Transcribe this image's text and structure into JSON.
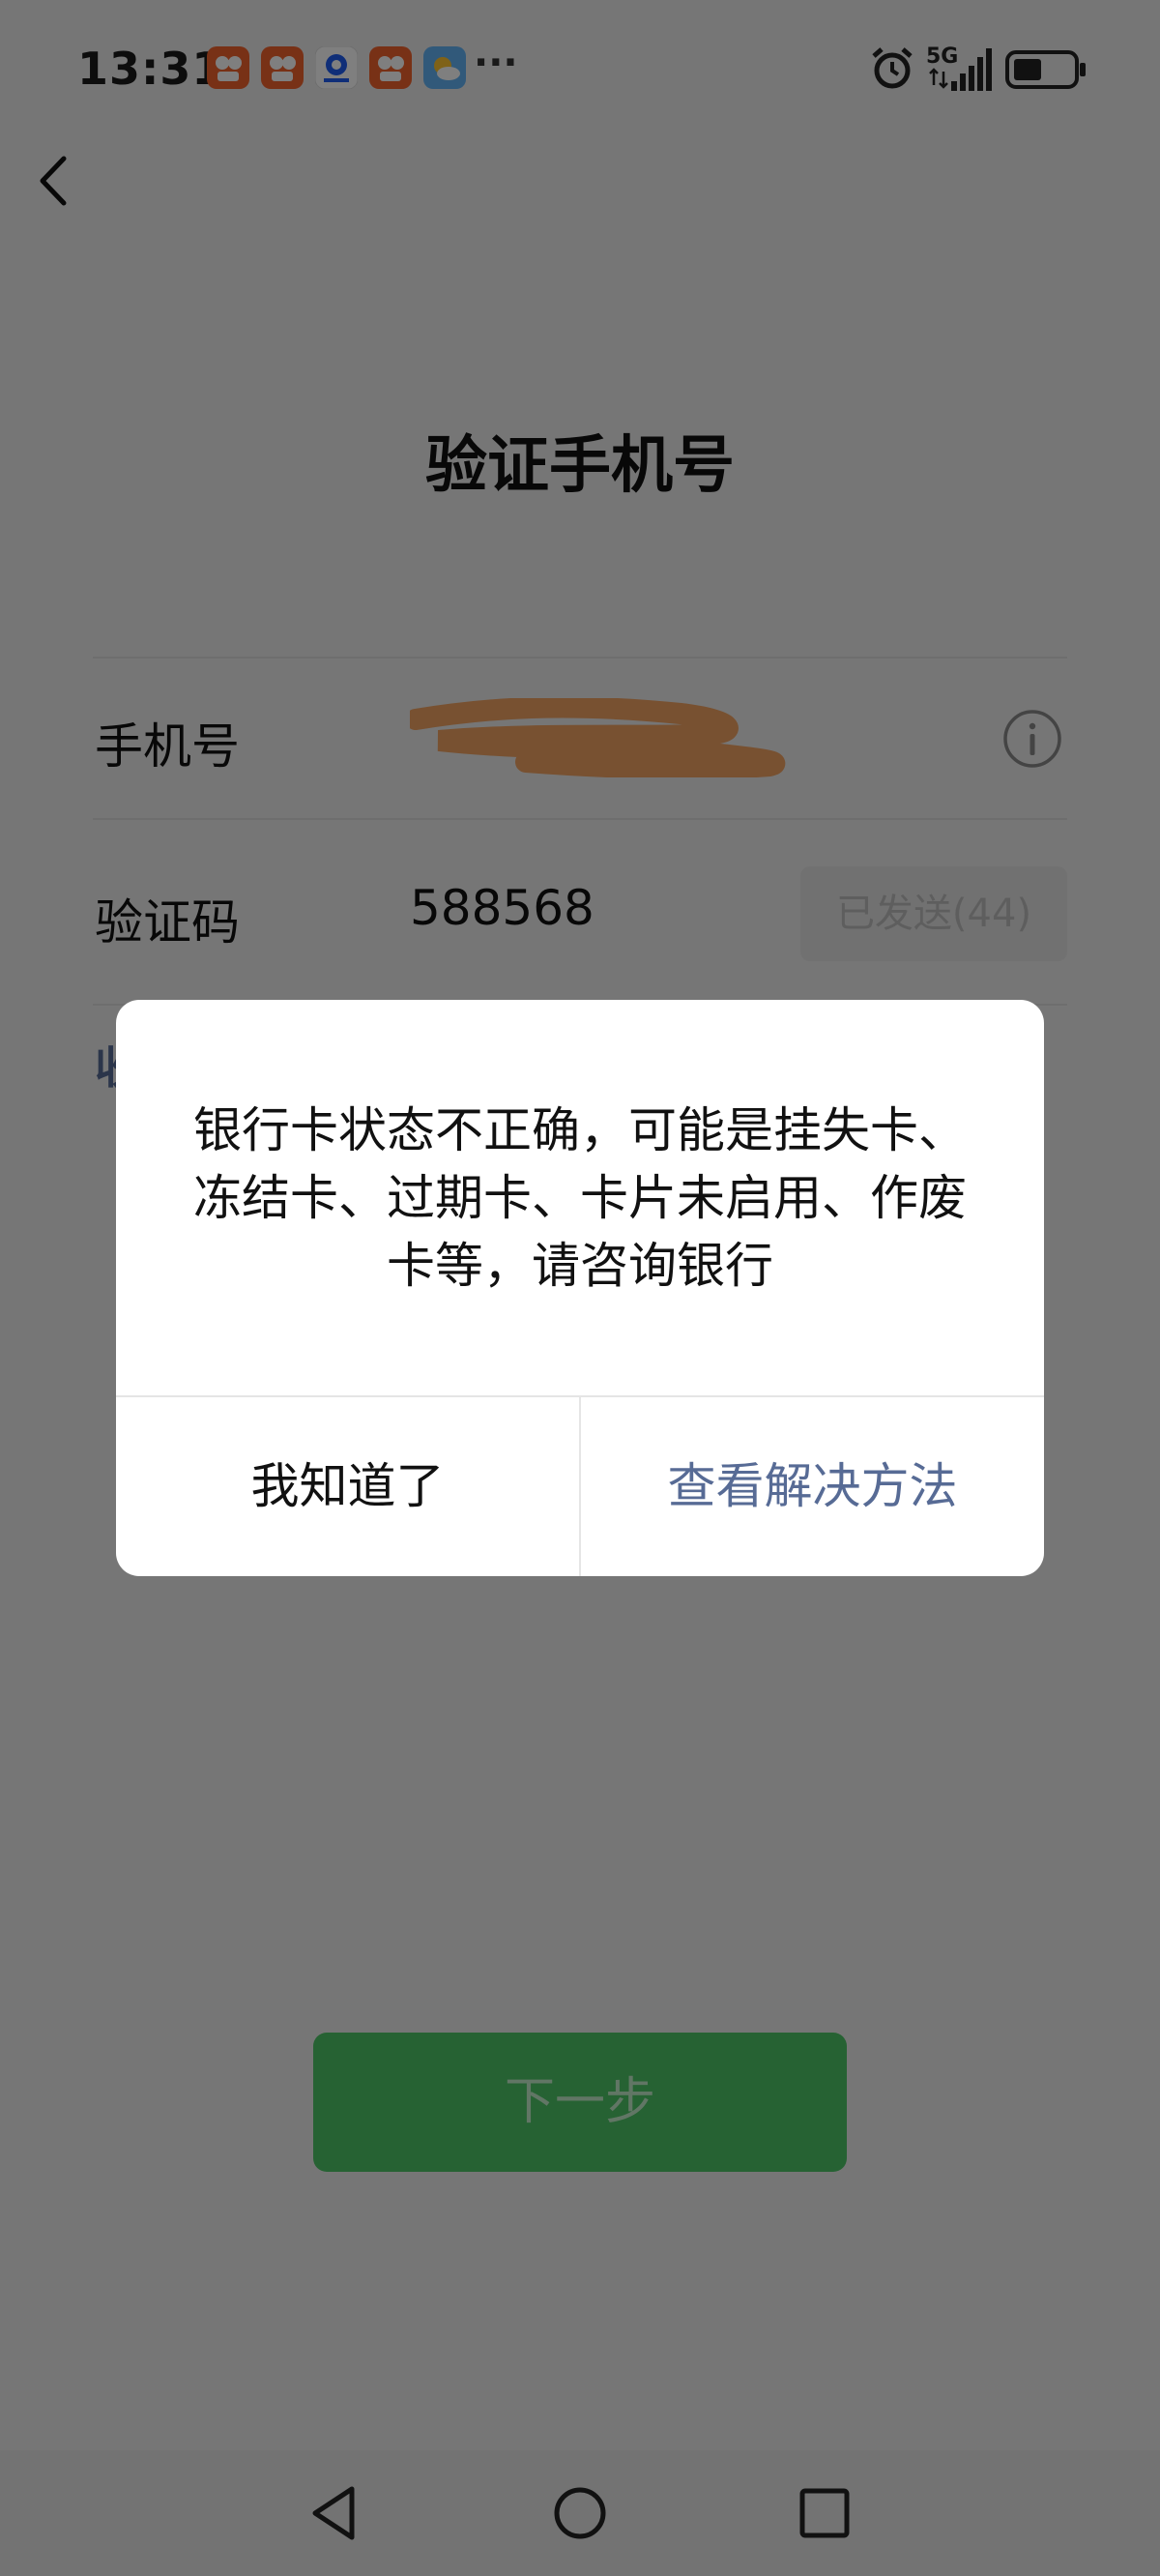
{
  "status_bar": {
    "time": "13:31",
    "more": "···",
    "network": "5G",
    "icons": [
      "app-icon",
      "app-icon",
      "app-icon",
      "app-icon",
      "weather-icon",
      "alarm-icon",
      "signal-icon",
      "battery-icon"
    ]
  },
  "page": {
    "title": "验证手机号",
    "phone_label": "手机号",
    "code_label": "验证码",
    "code_value": "588568",
    "resend_label": "已发送(44)",
    "link_partial": "收",
    "next_label": "下一步"
  },
  "dialog": {
    "message_line1": "银行卡状态不正确，可能是挂失卡、",
    "message_line2": "冻结卡、过期卡、卡片未启用、作废",
    "message_line3": "卡等，请咨询银行",
    "ok_label": "我知道了",
    "solution_label": "查看解决方法"
  },
  "colors": {
    "accent_link": "#576b95",
    "primary_green": "#4dc466",
    "mask_opacity": 0.5
  }
}
